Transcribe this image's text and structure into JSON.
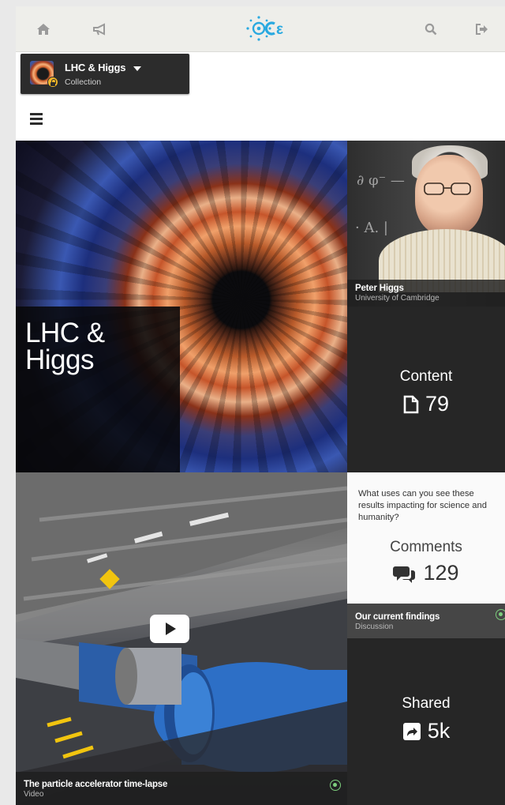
{
  "app": {
    "logo_text": "ε"
  },
  "topbar": {
    "icons": [
      "home-icon",
      "megaphone-icon",
      "search-icon",
      "logout-icon"
    ]
  },
  "collection": {
    "title": "LHC & Higgs",
    "subtitle": "Collection"
  },
  "hero": {
    "title_line1": "LHC &",
    "title_line2": "Higgs"
  },
  "person": {
    "name": "Peter Higgs",
    "affiliation": "University of Cambridge"
  },
  "content_stat": {
    "label": "Content",
    "value": "79"
  },
  "discussion": {
    "question": "What uses can you see these results impacting for science and humanity?",
    "comments_label": "Comments",
    "comments_value": "129",
    "title": "Our current findings",
    "type": "Discussion"
  },
  "shared_stat": {
    "label": "Shared",
    "value": "5k"
  },
  "video": {
    "title": "The particle accelerator time-lapse",
    "type": "Video"
  },
  "colors": {
    "accent": "#29a9e0",
    "tile_dark": "#262626",
    "check_green": "#7dce7d"
  }
}
